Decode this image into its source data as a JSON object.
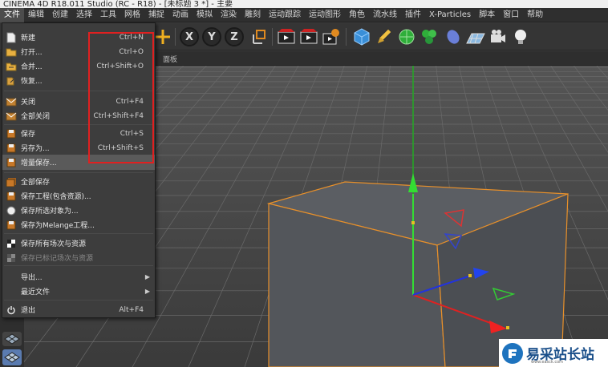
{
  "window": {
    "title": "CINEMA 4D R18.011 Studio (RC - R18) - [未标题 3 *] - 主要"
  },
  "menubar": {
    "items": [
      "文件",
      "编辑",
      "创建",
      "选择",
      "工具",
      "网格",
      "捕捉",
      "动画",
      "模拟",
      "渲染",
      "雕刻",
      "运动跟踪",
      "运动图形",
      "角色",
      "流水线",
      "插件",
      "X-Particles",
      "脚本",
      "窗口",
      "帮助"
    ]
  },
  "toolbar": {
    "axis_x": "X",
    "axis_y": "Y",
    "axis_z": "Z"
  },
  "viewport": {
    "header_label": "面板"
  },
  "file_menu": {
    "items": [
      {
        "label": "新建",
        "shortcut": "Ctrl+N",
        "icon": "new-file-icon"
      },
      {
        "label": "打开...",
        "shortcut": "Ctrl+O",
        "icon": "open-folder-icon"
      },
      {
        "label": "合并...",
        "shortcut": "Ctrl+Shift+O",
        "icon": "merge-icon"
      },
      {
        "label": "恢复...",
        "shortcut": "",
        "icon": "revert-icon"
      },
      {
        "label": "关闭",
        "shortcut": "Ctrl+F4",
        "icon": "close-file-icon"
      },
      {
        "label": "全部关闭",
        "shortcut": "Ctrl+Shift+F4",
        "icon": "close-all-icon"
      },
      {
        "label": "保存",
        "shortcut": "Ctrl+S",
        "icon": "save-icon"
      },
      {
        "label": "另存为...",
        "shortcut": "Ctrl+Shift+S",
        "icon": "save-as-icon"
      },
      {
        "label": "增量保存...",
        "shortcut": "",
        "icon": "incremental-save-icon"
      },
      {
        "label": "全部保存",
        "shortcut": "",
        "icon": "save-all-icon"
      },
      {
        "label": "保存工程(包含资源)...",
        "shortcut": "",
        "icon": "save-project-icon"
      },
      {
        "label": "保存所选对象为...",
        "shortcut": "",
        "icon": "save-selected-icon"
      },
      {
        "label": "保存为Melange工程...",
        "shortcut": "",
        "icon": "melange-icon"
      },
      {
        "label": "保存所有场次与资源",
        "shortcut": "",
        "icon": "save-takes-icon"
      },
      {
        "label": "保存已标记场次与资源",
        "shortcut": "",
        "icon": "save-marked-takes-icon",
        "disabled": true
      },
      {
        "label": "导出...",
        "shortcut": "",
        "icon": "",
        "submenu": true
      },
      {
        "label": "最近文件",
        "shortcut": "",
        "icon": "",
        "submenu": true
      },
      {
        "label": "退出",
        "shortcut": "Alt+F4",
        "icon": "power-icon"
      }
    ]
  },
  "watermark": {
    "text": "易采站长站",
    "url": "www.easck.com"
  },
  "colors": {
    "highlight_box": "#e02020",
    "y_axis": "#22cc22",
    "x_axis": "#dd2222",
    "z_axis": "#2233dd"
  }
}
